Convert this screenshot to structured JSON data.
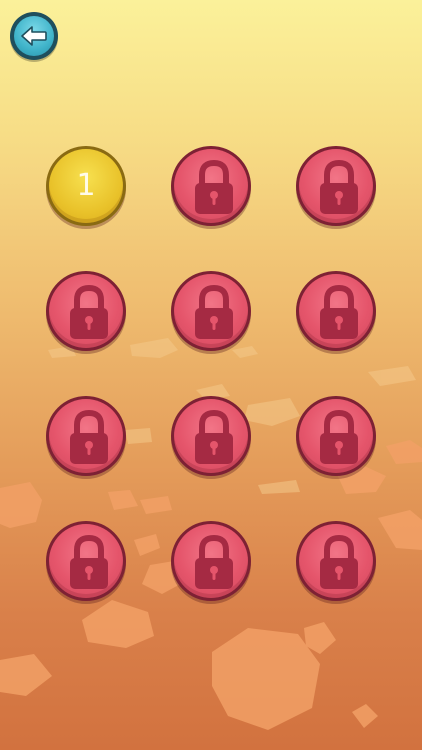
{
  "screen": "level-select",
  "colors": {
    "background_top": "#fbf19a",
    "background_bottom": "#d2723f",
    "locked_face": "#e5556b",
    "locked_rim": "#7d2134",
    "lock_glyph": "#a52a43",
    "unlocked_face": "#e9c22a",
    "unlocked_rim": "#8a6a12",
    "back_button": "#3fb3c9"
  },
  "back_button": {
    "icon": "back-arrow-icon"
  },
  "levels": [
    {
      "label": "1",
      "locked": false
    },
    {
      "label": "",
      "locked": true,
      "icon": "lock-icon"
    },
    {
      "label": "",
      "locked": true,
      "icon": "lock-icon"
    },
    {
      "label": "",
      "locked": true,
      "icon": "lock-icon"
    },
    {
      "label": "",
      "locked": true,
      "icon": "lock-icon"
    },
    {
      "label": "",
      "locked": true,
      "icon": "lock-icon"
    },
    {
      "label": "",
      "locked": true,
      "icon": "lock-icon"
    },
    {
      "label": "",
      "locked": true,
      "icon": "lock-icon"
    },
    {
      "label": "",
      "locked": true,
      "icon": "lock-icon"
    },
    {
      "label": "",
      "locked": true,
      "icon": "lock-icon"
    },
    {
      "label": "",
      "locked": true,
      "icon": "lock-icon"
    },
    {
      "label": "",
      "locked": true,
      "icon": "lock-icon"
    }
  ]
}
